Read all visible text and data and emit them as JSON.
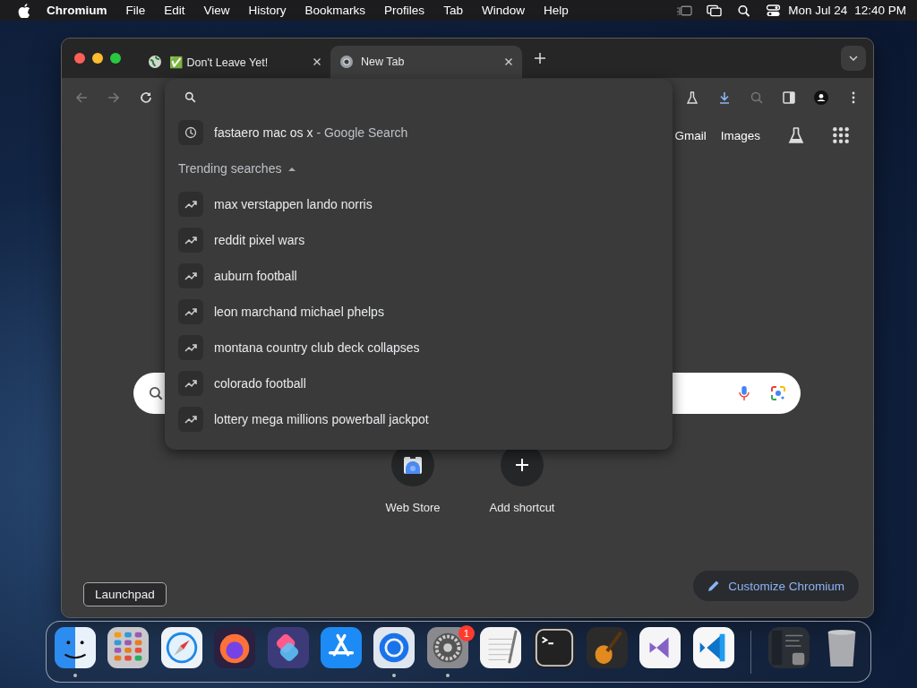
{
  "menu_bar": {
    "app_name": "Chromium",
    "items": [
      "File",
      "Edit",
      "View",
      "History",
      "Bookmarks",
      "Profiles",
      "Tab",
      "Window",
      "Help"
    ],
    "date": "Mon Jul 24",
    "time": "12:40 PM"
  },
  "browser": {
    "tabs": [
      {
        "title": "✅ Don't Leave Yet!",
        "kind": "site",
        "selected": false
      },
      {
        "title": "New Tab",
        "kind": "newtab",
        "selected": true
      }
    ],
    "toolbar": {
      "back_disabled": true,
      "forward_disabled": true
    },
    "omnibox_dropdown": {
      "suggestions": [
        {
          "query": "fastaero mac os x",
          "source": " - Google Search"
        }
      ],
      "trending_heading": "Trending searches",
      "trending_expanded": true,
      "trending": [
        "max verstappen lando norris",
        "reddit pixel wars",
        "auburn football",
        "leon marchand michael phelps",
        "montana country club deck collapses",
        "colorado football",
        "lottery mega millions powerball jackpot"
      ]
    },
    "new_tab_page": {
      "links": [
        "Gmail",
        "Images"
      ],
      "shortcuts": [
        {
          "label": "Web Store",
          "kind": "store"
        },
        {
          "label": "Add shortcut",
          "kind": "add"
        }
      ],
      "customize_button": "Customize Chromium"
    }
  },
  "dock": {
    "tooltip": "Launchpad",
    "apps": [
      {
        "kind": "finder",
        "running": true
      },
      {
        "kind": "launchpad",
        "running": false
      },
      {
        "kind": "safari",
        "running": false
      },
      {
        "kind": "firefox",
        "running": false
      },
      {
        "kind": "shortcuts",
        "running": false
      },
      {
        "kind": "appstore",
        "running": false
      },
      {
        "kind": "chromium",
        "running": true
      },
      {
        "kind": "settings",
        "running": true,
        "badge": "1"
      },
      {
        "kind": "textedit",
        "running": false
      },
      {
        "kind": "terminal",
        "running": false
      },
      {
        "kind": "garageband",
        "running": false
      },
      {
        "kind": "visualstudio",
        "running": false
      },
      {
        "kind": "vscode",
        "running": false
      },
      {
        "kind": "separator"
      },
      {
        "kind": "preview",
        "running": false
      },
      {
        "kind": "trash",
        "running": false
      }
    ]
  }
}
